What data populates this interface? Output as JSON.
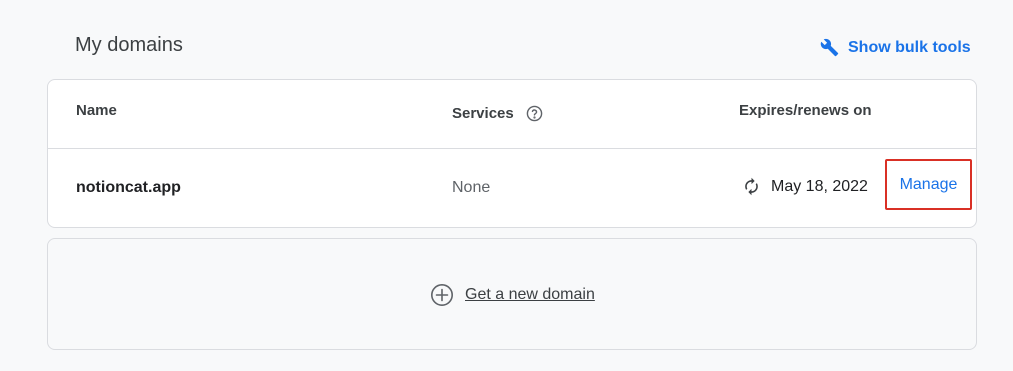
{
  "header": {
    "title": "My domains",
    "bulk_tools_label": "Show bulk tools",
    "bulk_tools_icon": "wrench-icon"
  },
  "table": {
    "columns": {
      "name": "Name",
      "services": "Services",
      "services_help_icon": "help-circle-icon",
      "expires": "Expires/renews on"
    },
    "rows": [
      {
        "name": "notioncat.app",
        "services": "None",
        "renew_icon": "autorenew-icon",
        "expires": "May 18, 2022",
        "action_label": "Manage"
      }
    ]
  },
  "new_domain": {
    "label": "Get a new domain",
    "icon": "add-circle-icon"
  },
  "colors": {
    "accent": "#1a73e8",
    "highlight_border": "#d93025",
    "text_primary": "#202124",
    "text_secondary": "#5f6368",
    "border": "#dadce0",
    "background": "#f8f9fa"
  }
}
